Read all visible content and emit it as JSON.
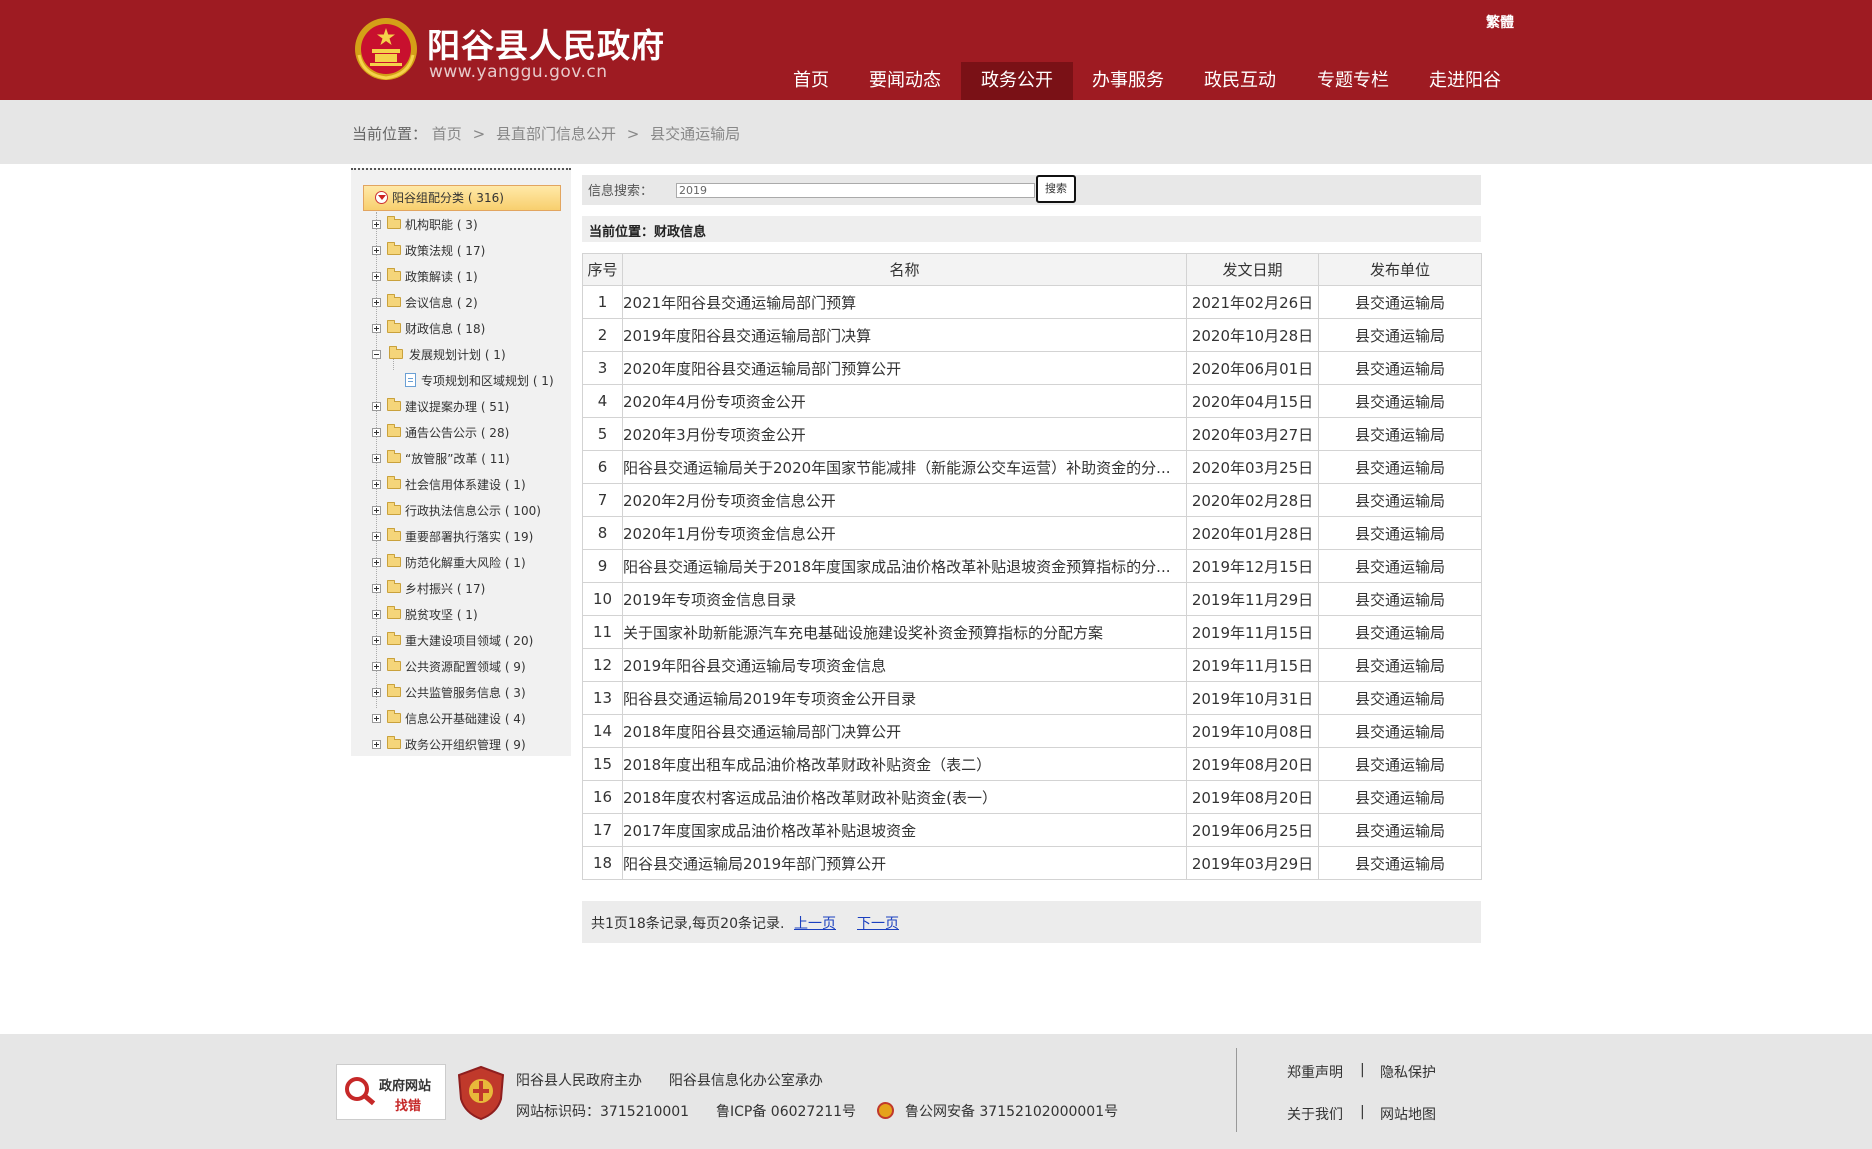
{
  "header": {
    "site_title": "阳谷县人民政府",
    "site_url": "www.yanggu.gov.cn",
    "lang_toggle": "繁體",
    "nav": [
      {
        "label": "首页",
        "active": false
      },
      {
        "label": "要闻动态",
        "active": false
      },
      {
        "label": "政务公开",
        "active": true
      },
      {
        "label": "办事服务",
        "active": false
      },
      {
        "label": "政民互动",
        "active": false
      },
      {
        "label": "专题专栏",
        "active": false
      },
      {
        "label": "走进阳谷",
        "active": false
      }
    ],
    "colors": {
      "primary": "#9e1b22",
      "active": "#7a1116"
    }
  },
  "breadcrumb": {
    "label": "当前位置：",
    "items": [
      "首页",
      "县直部门信息公开",
      "县交通运输局"
    ],
    "separator": ">"
  },
  "tree": {
    "root": "阳谷组配分类 ( 316)",
    "nodes": [
      {
        "label": "机构职能 ( 3)",
        "type": "folder",
        "expanded": false
      },
      {
        "label": "政策法规 ( 17)",
        "type": "folder",
        "expanded": false
      },
      {
        "label": "政策解读 ( 1)",
        "type": "folder",
        "expanded": false
      },
      {
        "label": "会议信息 ( 2)",
        "type": "folder",
        "expanded": false
      },
      {
        "label": "财政信息 ( 18)",
        "type": "folder",
        "expanded": false
      },
      {
        "label": "发展规划计划 ( 1)",
        "type": "folder",
        "expanded": true
      },
      {
        "label": "专项规划和区域规划 ( 1)",
        "type": "doc",
        "expanded": false
      },
      {
        "label": "建议提案办理 ( 51)",
        "type": "folder",
        "expanded": false
      },
      {
        "label": "通告公告公示 ( 28)",
        "type": "folder",
        "expanded": false
      },
      {
        "label": "“放管服”改革 ( 11)",
        "type": "folder",
        "expanded": false
      },
      {
        "label": "社会信用体系建设 ( 1)",
        "type": "folder",
        "expanded": false
      },
      {
        "label": "行政执法信息公示 ( 100)",
        "type": "folder",
        "expanded": false
      },
      {
        "label": "重要部署执行落实 ( 19)",
        "type": "folder",
        "expanded": false
      },
      {
        "label": "防范化解重大风险 ( 1)",
        "type": "folder",
        "expanded": false
      },
      {
        "label": "乡村振兴 ( 17)",
        "type": "folder",
        "expanded": false
      },
      {
        "label": "脱贫攻坚 ( 1)",
        "type": "folder",
        "expanded": false
      },
      {
        "label": "重大建设项目领域 ( 20)",
        "type": "folder",
        "expanded": false
      },
      {
        "label": "公共资源配置领域 ( 9)",
        "type": "folder",
        "expanded": false
      },
      {
        "label": "公共监管服务信息 ( 3)",
        "type": "folder",
        "expanded": false
      },
      {
        "label": "信息公开基础建设 ( 4)",
        "type": "folder",
        "expanded": false
      },
      {
        "label": "政务公开组织管理 ( 9)",
        "type": "folder",
        "expanded": false
      }
    ]
  },
  "search": {
    "label": "信息搜索：",
    "value": "2019",
    "button": "搜索"
  },
  "current_position": "当前位置：财政信息",
  "table": {
    "headers": [
      "序号",
      "名称",
      "发文日期",
      "发布单位"
    ],
    "rows": [
      {
        "no": "1",
        "name": "2021年阳谷县交通运输局部门预算",
        "date": "2021年02月26日",
        "unit": "县交通运输局"
      },
      {
        "no": "2",
        "name": "2019年度阳谷县交通运输局部门决算",
        "date": "2020年10月28日",
        "unit": "县交通运输局"
      },
      {
        "no": "3",
        "name": "2020年度阳谷县交通运输局部门预算公开",
        "date": "2020年06月01日",
        "unit": "县交通运输局"
      },
      {
        "no": "4",
        "name": "2020年4月份专项资金公开",
        "date": "2020年04月15日",
        "unit": "县交通运输局"
      },
      {
        "no": "5",
        "name": "2020年3月份专项资金公开",
        "date": "2020年03月27日",
        "unit": "县交通运输局"
      },
      {
        "no": "6",
        "name": "阳谷县交通运输局关于2020年国家节能减排（新能源公交车运营）补助资金的分...",
        "date": "2020年03月25日",
        "unit": "县交通运输局"
      },
      {
        "no": "7",
        "name": "2020年2月份专项资金信息公开",
        "date": "2020年02月28日",
        "unit": "县交通运输局"
      },
      {
        "no": "8",
        "name": "2020年1月份专项资金信息公开",
        "date": "2020年01月28日",
        "unit": "县交通运输局"
      },
      {
        "no": "9",
        "name": "阳谷县交通运输局关于2018年度国家成品油价格改革补贴退坡资金预算指标的分...",
        "date": "2019年12月15日",
        "unit": "县交通运输局"
      },
      {
        "no": "10",
        "name": "2019年专项资金信息目录",
        "date": "2019年11月29日",
        "unit": "县交通运输局"
      },
      {
        "no": "11",
        "name": "关于国家补助新能源汽车充电基础设施建设奖补资金预算指标的分配方案",
        "date": "2019年11月15日",
        "unit": "县交通运输局"
      },
      {
        "no": "12",
        "name": "2019年阳谷县交通运输局专项资金信息",
        "date": "2019年11月15日",
        "unit": "县交通运输局"
      },
      {
        "no": "13",
        "name": "阳谷县交通运输局2019年专项资金公开目录",
        "date": "2019年10月31日",
        "unit": "县交通运输局"
      },
      {
        "no": "14",
        "name": "2018年度阳谷县交通运输局部门决算公开",
        "date": "2019年10月08日",
        "unit": "县交通运输局"
      },
      {
        "no": "15",
        "name": "2018年度出租车成品油价格改革财政补贴资金（表二）",
        "date": "2019年08月20日",
        "unit": "县交通运输局"
      },
      {
        "no": "16",
        "name": "2018年度农村客运成品油价格改革财政补贴资金(表一）",
        "date": "2019年08月20日",
        "unit": "县交通运输局"
      },
      {
        "no": "17",
        "name": "2017年度国家成品油价格改革补贴退坡资金",
        "date": "2019年06月25日",
        "unit": "县交通运输局"
      },
      {
        "no": "18",
        "name": "阳谷县交通运输局2019年部门预算公开",
        "date": "2019年03月29日",
        "unit": "县交通运输局"
      }
    ]
  },
  "pager": {
    "summary": "共1页18条记录,每页20条记录.",
    "prev": "上一页",
    "next": "下一页"
  },
  "footer": {
    "badge_report_line1": "政府网站",
    "badge_report_line2": "找错",
    "sponsor": "阳谷县人民政府主办",
    "organizer": "阳谷县信息化办公室承办",
    "site_id": "网站标识码：3715210001",
    "icp": "鲁ICP备 06027211号",
    "police": "鲁公网安备 37152102000001号",
    "links": [
      "郑重声明",
      "隐私保护",
      "关于我们",
      "网站地图"
    ],
    "link_separator": "|"
  }
}
